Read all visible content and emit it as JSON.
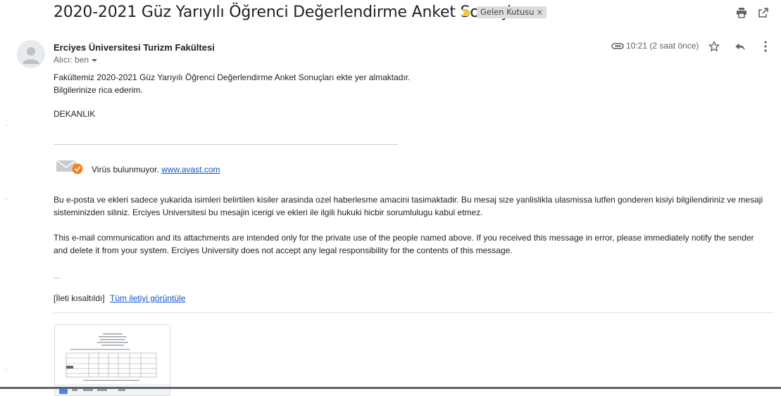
{
  "subject": "2020-2021 Güz Yarıyılı Öğrenci Değerlendirme Anket Sonuçları",
  "label": {
    "text": "Gelen Kutusu",
    "remove": "×"
  },
  "sender": {
    "name": "Erciyes Üniversitesi Turizm Fakültesi",
    "to": "Alıcı: ben"
  },
  "time": "10:21 (2 saat önce)",
  "body": {
    "line1": "Fakültemiz 2020-2021 Güz Yarıyılı Öğrenci Değerlendirme Anket Sonuçları ekte yer almaktadır.",
    "line2": "Bilgilerinize rica ederim.",
    "signature": "DEKANLIK",
    "virus_text": "Virüs bulunmuyor.",
    "virus_link": "www.avast.com",
    "disclaimer_tr": "Bu e-posta ve ekleri sadece yukarida isimleri belirtilen kisiler arasinda ozel haberlesme amacini tasimaktadir. Bu mesaj size yanlislikla ulasmissa lutfen gonderen kisiyi bilgilendiriniz ve mesaji sisteminizden siliniz. Erciyes Universitesi bu mesajin icerigi ve ekleri ile ilgili hukuki hicbir sorumlulugu kabul etmez.",
    "disclaimer_en": "This e-mail communication and its attachments are intended only for the private use of the people named above. If you received this message in error, please immediately notify the sender and delete it from your system. Erciyes University does not accept any legal responsibility for the contents of this message.",
    "ellipsis": "...",
    "clipped": "[İleti kısaltıldı]",
    "view_full": "Tüm iletiyi görüntüle"
  },
  "colors": {
    "label_bg": "#dddddd",
    "importance": "#f2c744",
    "avast_orange": "#f58220",
    "link": "#1155cc"
  },
  "icons": [
    "print-icon",
    "open-in-new-window-icon",
    "avatar-person-icon",
    "attachment-clip-icon",
    "star-icon",
    "reply-icon",
    "more-vert-icon",
    "envelope-icon",
    "check-badge-icon"
  ]
}
